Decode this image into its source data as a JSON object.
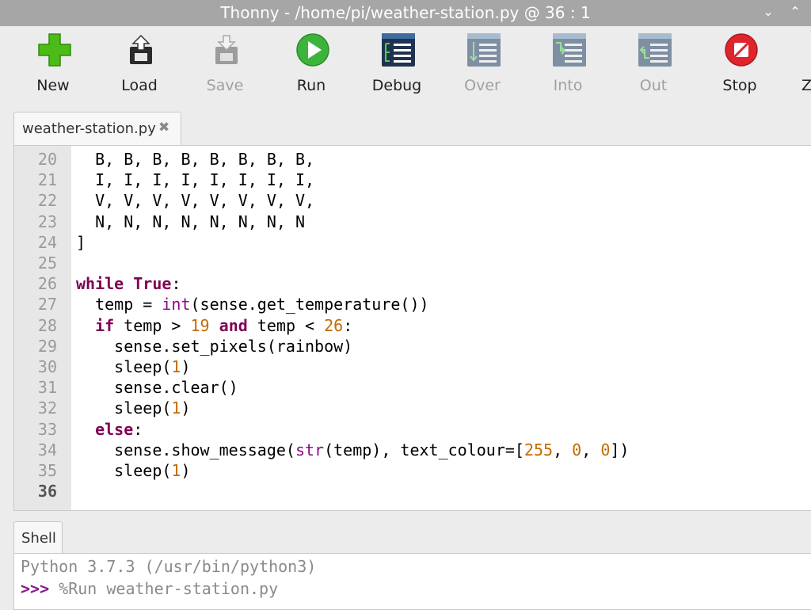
{
  "window": {
    "title": "Thonny  -  /home/pi/weather-station.py  @  36 : 1",
    "controls": [
      "chevron-down-icon",
      "chevron-up-icon"
    ]
  },
  "toolbar": {
    "buttons": [
      {
        "label": "New",
        "icon": "new-file-plus-icon",
        "enabled": true,
        "color": "#4cbb17"
      },
      {
        "label": "Load",
        "icon": "load-icon",
        "enabled": true
      },
      {
        "label": "Save",
        "icon": "save-icon",
        "enabled": false
      },
      {
        "label": "Run",
        "icon": "run-icon",
        "enabled": true,
        "color": "#3cb43c"
      },
      {
        "label": "Debug",
        "icon": "debug-icon",
        "enabled": true
      },
      {
        "label": "Over",
        "icon": "step-over-icon",
        "enabled": false
      },
      {
        "label": "Into",
        "icon": "step-into-icon",
        "enabled": false
      },
      {
        "label": "Out",
        "icon": "step-out-icon",
        "enabled": false
      },
      {
        "label": "Stop",
        "icon": "stop-icon",
        "enabled": true,
        "color": "#e0242c"
      }
    ]
  },
  "editor": {
    "tab": {
      "name": "weather-station.py",
      "close": "✖"
    },
    "current_line": 36,
    "lines": [
      {
        "n": "20",
        "code": "  B, B, B, B, B, B, B, B,"
      },
      {
        "n": "21",
        "code": "  I, I, I, I, I, I, I, I,"
      },
      {
        "n": "22",
        "code": "  V, V, V, V, V, V, V, V,"
      },
      {
        "n": "23",
        "code": "  N, N, N, N, N, N, N, N"
      },
      {
        "n": "24",
        "code": "]"
      },
      {
        "n": "25",
        "code": ""
      },
      {
        "n": "26",
        "code": "while True:"
      },
      {
        "n": "27",
        "code": "  temp = int(sense.get_temperature())"
      },
      {
        "n": "28",
        "code": "  if temp > 19 and temp < 26:"
      },
      {
        "n": "29",
        "code": "    sense.set_pixels(rainbow)"
      },
      {
        "n": "30",
        "code": "    sleep(1)"
      },
      {
        "n": "31",
        "code": "    sense.clear()"
      },
      {
        "n": "32",
        "code": "    sleep(1)"
      },
      {
        "n": "33",
        "code": "  else:"
      },
      {
        "n": "34",
        "code": "    sense.show_message(str(temp), text_colour=[255, 0, 0])"
      },
      {
        "n": "35",
        "code": "    sleep(1)"
      },
      {
        "n": "36",
        "code": ""
      }
    ]
  },
  "shell": {
    "tab": "Shell",
    "line1": "Python 3.7.3 (/usr/bin/python3)",
    "prompt": ">>>",
    "command": " %Run weather-station.py"
  },
  "colors": {
    "keyword": "#7f0055",
    "builtin": "#8b0a8b",
    "number": "#c46a00",
    "titlebar": "#a6a6a6"
  }
}
